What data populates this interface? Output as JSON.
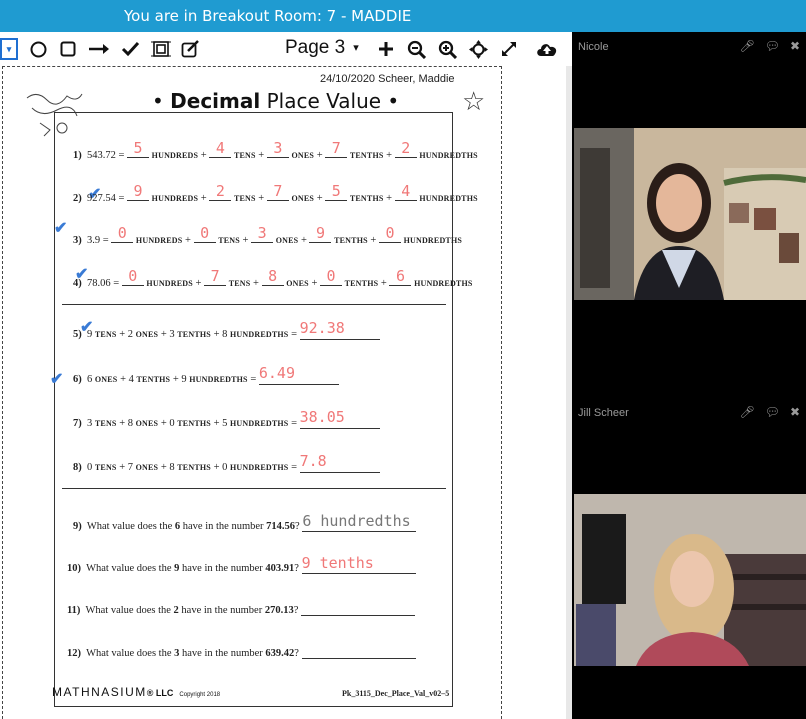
{
  "topbar": {
    "text": "You are in Breakout Room: 7 - MADDIE"
  },
  "toolbar": {
    "page_label": "Page 3",
    "tools": [
      "pen-dropdown-icon",
      "circle-icon",
      "square-icon",
      "arrow-icon",
      "checkmark-icon",
      "select-box-icon",
      "edit-icon"
    ],
    "right_tools": [
      "plus-icon",
      "zoom-out-icon",
      "zoom-in-icon",
      "move-icon",
      "expand-icon",
      "cloud-upload-icon"
    ]
  },
  "worksheet": {
    "date_name": "24/10/2020 Scheer, Maddie",
    "title_bold": "Decimal",
    "title_rest": "Place Value",
    "bullet": "•",
    "units": {
      "hundreds": "HUNDREDS",
      "tens": "TENS",
      "ones": "ONES",
      "tenths": "TENTHS",
      "hundredths": "HUNDREDTHS"
    },
    "section1": [
      {
        "num": "1)",
        "value": "543.72 =",
        "answers": [
          "5",
          "4",
          "3",
          "7",
          "2"
        ]
      },
      {
        "num": "2)",
        "value": "927.54 =",
        "answers": [
          "9",
          "2",
          "7",
          "5",
          "4"
        ]
      },
      {
        "num": "3)",
        "value": "3.9 =",
        "answers": [
          "0",
          "0",
          "3",
          "9",
          "0"
        ]
      },
      {
        "num": "4)",
        "value": "78.06 =",
        "answers": [
          "0",
          "7",
          "8",
          "0",
          "6"
        ]
      }
    ],
    "section2": [
      {
        "num": "5)",
        "text_a": "9",
        "unit_a": "TENS",
        "text_b": "+ 2",
        "unit_b": "ONES",
        "text_c": "+ 3",
        "unit_c": "TENTHS",
        "text_d": "+ 8",
        "unit_d": "HUNDREDTHS",
        "eq": "=",
        "answer": "92.38"
      },
      {
        "num": "6)",
        "text_a": "6",
        "unit_a": "ONES",
        "text_b": "+ 4",
        "unit_b": "TENTHS",
        "text_c": "+ 9",
        "unit_c": "HUNDREDTHS",
        "text_d": "",
        "unit_d": "",
        "eq": "=",
        "answer": "6.49"
      },
      {
        "num": "7)",
        "text_a": "3",
        "unit_a": "TENS",
        "text_b": "+ 8",
        "unit_b": "ONES",
        "text_c": "+ 0",
        "unit_c": "TENTHS",
        "text_d": "+ 5",
        "unit_d": "HUNDREDTHS",
        "eq": "=",
        "answer": "38.05"
      },
      {
        "num": "8)",
        "text_a": "0",
        "unit_a": "TENS",
        "text_b": "+ 7",
        "unit_b": "ONES",
        "text_c": "+ 8",
        "unit_c": "TENTHS",
        "text_d": "+ 0",
        "unit_d": "HUNDREDTHS",
        "eq": "=",
        "answer": "7.8"
      }
    ],
    "section3": [
      {
        "num": "9)",
        "pre": "What value does the",
        "digit": "6",
        "mid": "have in the number",
        "number": "714.56",
        "q": "?",
        "answer": "6 hundredths"
      },
      {
        "num": "10)",
        "pre": "What value does the",
        "digit": "9",
        "mid": "have in the number",
        "number": "403.91",
        "q": "?",
        "answer": "9 tenths"
      },
      {
        "num": "11)",
        "pre": "What value does the",
        "digit": "2",
        "mid": "have in the number",
        "number": "270.13",
        "q": "?",
        "answer": ""
      },
      {
        "num": "12)",
        "pre": "What value does the",
        "digit": "3",
        "mid": "have in the number",
        "number": "639.42",
        "q": "?",
        "answer": ""
      }
    ],
    "footer_logo": "MATHNASIUM",
    "footer_llc": "® LLC",
    "footer_copyright": "Copyright 2018",
    "footer_code": "Pk_3115_Dec_Place_Val_v02–5"
  },
  "videos": [
    {
      "name": "Nicole"
    },
    {
      "name": "Jill Scheer"
    }
  ],
  "colors": {
    "topbar": "#1f9bd1",
    "answer": "#f07878",
    "check": "#3a7bd5"
  }
}
